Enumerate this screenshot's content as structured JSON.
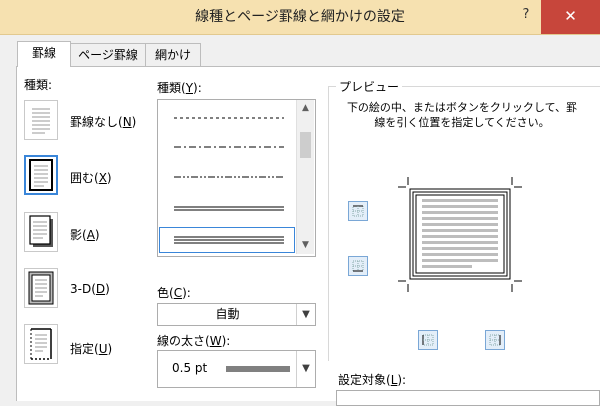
{
  "window": {
    "title": "線種とページ罫線と網かけの設定",
    "help_label": "?",
    "close_label": "✕"
  },
  "tabs": [
    {
      "label": "罫線",
      "active": true
    },
    {
      "label": "ページ罫線",
      "active": false
    },
    {
      "label": "網かけ",
      "active": false
    }
  ],
  "setting": {
    "heading": "種類:",
    "items": [
      {
        "label_pre": "罫線なし(",
        "key": "N",
        "label_post": ")",
        "icon": "border-none-icon",
        "selected": false
      },
      {
        "label_pre": "囲む(",
        "key": "X",
        "label_post": ")",
        "icon": "border-box-icon",
        "selected": true
      },
      {
        "label_pre": "影(",
        "key": "A",
        "label_post": ")",
        "icon": "border-shadow-icon",
        "selected": false
      },
      {
        "label_pre": "3-D(",
        "key": "D",
        "label_post": ")",
        "icon": "border-3d-icon",
        "selected": false
      },
      {
        "label_pre": "指定(",
        "key": "U",
        "label_post": ")",
        "icon": "border-custom-icon",
        "selected": false
      }
    ]
  },
  "style": {
    "label_pre": "種類(",
    "key": "Y",
    "label_post": "):",
    "items": [
      "dashed-fine",
      "dash-dot",
      "dash-dot-dot",
      "double",
      "triple"
    ],
    "selected_index": 4
  },
  "color": {
    "label_pre": "色(",
    "key": "C",
    "label_post": "):",
    "value": "自動"
  },
  "width": {
    "label_pre": "線の太さ(",
    "key": "W",
    "label_post": "):",
    "value": "0.5 pt"
  },
  "preview": {
    "group_label": "プレビュー",
    "instructions": "下の絵の中、またはボタンをクリックして、罫線を引く位置を指定してください。"
  },
  "apply_to": {
    "label_pre": "設定対象(",
    "key": "L",
    "label_post": "):"
  },
  "colors": {
    "title_bar": "#f6e1b0",
    "close_button": "#c7463b",
    "accent": "#3a86d9"
  }
}
